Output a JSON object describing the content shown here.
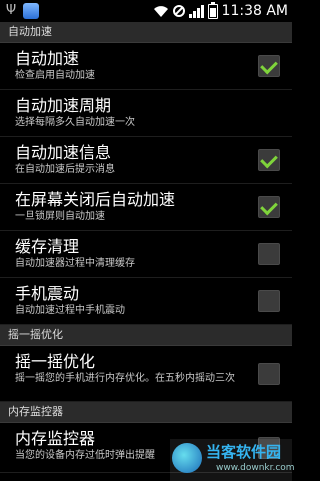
{
  "status_bar": {
    "time": "11:38 AM",
    "left_icons": [
      "usb-icon",
      "app-icon"
    ],
    "right_icons": [
      "wifi-icon",
      "no-sim-icon",
      "signal-icon",
      "battery-icon"
    ]
  },
  "sections": [
    {
      "header": "自动加速",
      "items": [
        {
          "title": "自动加速",
          "summary": "检查启用自动加速",
          "checkbox": true,
          "checked": true
        },
        {
          "title": "自动加速周期",
          "summary": "选择每隔多久自动加速一次",
          "checkbox": false,
          "checked": false
        },
        {
          "title": "自动加速信息",
          "summary": "在自动加速后提示消息",
          "checkbox": true,
          "checked": true
        },
        {
          "title": "在屏幕关闭后自动加速",
          "summary": "一旦锁屏则自动加速",
          "checkbox": true,
          "checked": true
        },
        {
          "title": "缓存清理",
          "summary": "自动加速器过程中清理缓存",
          "checkbox": true,
          "checked": false
        },
        {
          "title": "手机震动",
          "summary": "自动加速过程中手机震动",
          "checkbox": true,
          "checked": false
        }
      ]
    },
    {
      "header": "摇一摇优化",
      "items": [
        {
          "title": "摇一摇优化",
          "summary": "摇一摇您的手机进行内存优化。在五秒内摇动三次",
          "checkbox": true,
          "checked": false
        }
      ]
    },
    {
      "header": "内存监控器",
      "items": [
        {
          "title": "内存监控器",
          "summary": "当您的设备内存过低时弹出提醒",
          "checkbox": true,
          "checked": false
        }
      ]
    }
  ],
  "watermark": {
    "text": "当客软件园",
    "url": "www.downkr.com"
  },
  "colors": {
    "background": "#000000",
    "section_header": "#2b2b2b",
    "check_accent": "#7fd43b"
  }
}
